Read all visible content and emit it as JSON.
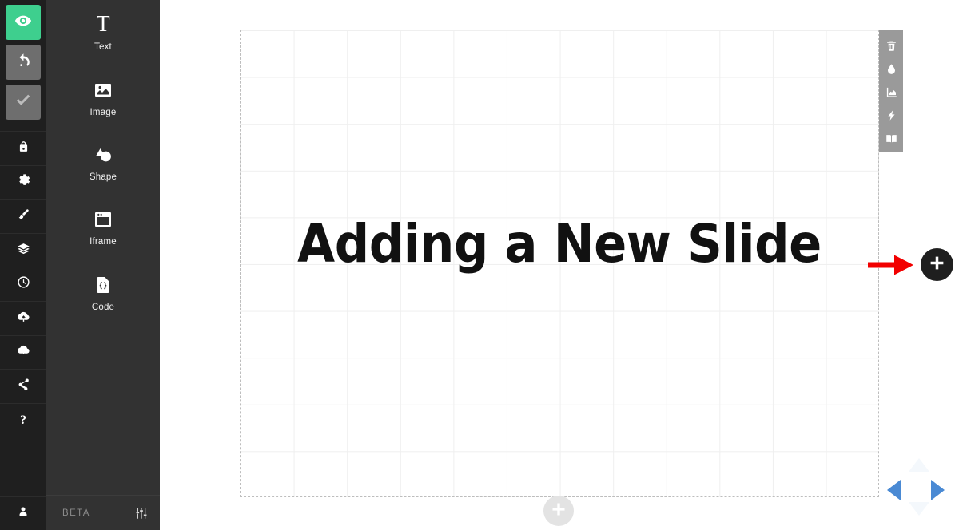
{
  "app": {
    "beta_label": "BETA"
  },
  "rail": {
    "actions": [
      {
        "name": "preview-button",
        "icon": "eye-icon",
        "state": "active"
      },
      {
        "name": "undo-button",
        "icon": "undo-icon",
        "state": "enabled"
      },
      {
        "name": "confirm-button",
        "icon": "check-icon",
        "state": "disabled"
      }
    ],
    "items": [
      {
        "name": "sidebar-item-lock",
        "icon": "lock-icon"
      },
      {
        "name": "sidebar-item-settings",
        "icon": "gear-icon"
      },
      {
        "name": "sidebar-item-theme",
        "icon": "paintbrush-icon"
      },
      {
        "name": "sidebar-item-layers",
        "icon": "layers-icon"
      },
      {
        "name": "sidebar-item-history",
        "icon": "clock-icon"
      },
      {
        "name": "sidebar-item-upload",
        "icon": "cloud-upload-icon"
      },
      {
        "name": "sidebar-item-download",
        "icon": "cloud-download-icon"
      },
      {
        "name": "sidebar-item-share",
        "icon": "share-icon"
      },
      {
        "name": "sidebar-item-help",
        "icon": "question-icon",
        "glyph": "?"
      }
    ],
    "user": {
      "name": "user-account-button",
      "icon": "person-icon"
    }
  },
  "tools": [
    {
      "label": "Text",
      "icon": "text-icon",
      "glyph": "T"
    },
    {
      "label": "Image",
      "icon": "image-icon"
    },
    {
      "label": "Shape",
      "icon": "shape-icon"
    },
    {
      "label": "Iframe",
      "icon": "iframe-icon"
    },
    {
      "label": "Code",
      "icon": "code-icon"
    }
  ],
  "tools_footer": {
    "settings_icon": "sliders-icon"
  },
  "slide": {
    "title": "Adding a New Slide",
    "grid": {
      "columns": 12,
      "rows": 10
    }
  },
  "context_toolbar": [
    {
      "name": "delete-element-button",
      "icon": "trash-icon"
    },
    {
      "name": "background-color-button",
      "icon": "droplet-icon"
    },
    {
      "name": "chart-button",
      "icon": "chart-icon"
    },
    {
      "name": "animation-button",
      "icon": "lightning-icon"
    },
    {
      "name": "notes-button",
      "icon": "book-icon"
    }
  ],
  "annotation": {
    "arrow": {
      "name": "red-arrow-annotation",
      "color": "#f20000",
      "direction": "right"
    }
  },
  "add_buttons": {
    "right": {
      "name": "add-slide-button-right",
      "icon": "plus-icon",
      "color": "#1f1f1f"
    },
    "bottom": {
      "name": "add-slide-button-bottom",
      "icon": "plus-icon",
      "color": "#e3e3e3"
    }
  },
  "navigation": {
    "up": {
      "name": "nav-up-arrow",
      "state": "inactive",
      "color": "#f4f8fc"
    },
    "down": {
      "name": "nav-down-arrow",
      "state": "inactive",
      "color": "#f4f8fc"
    },
    "left": {
      "name": "nav-left-arrow",
      "state": "active",
      "color": "#4a8ad4"
    },
    "right": {
      "name": "nav-right-arrow",
      "state": "active",
      "color": "#4a8ad4"
    }
  },
  "colors": {
    "rail_bg": "#1f1f1f",
    "tools_bg": "#323232",
    "accent_green": "#3ecf8e",
    "toolbar_gray": "#9a9a9a",
    "annotation_red": "#f20000",
    "nav_blue": "#4a8ad4"
  }
}
